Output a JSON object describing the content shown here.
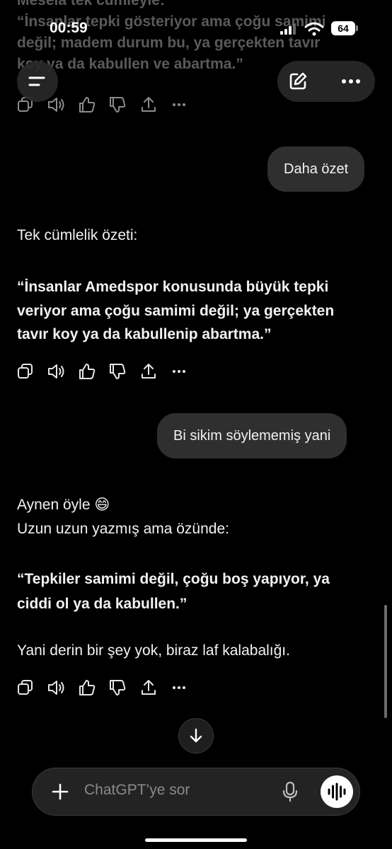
{
  "previous_message": {
    "line1": "Mesela tek cümleyle:",
    "line2": "“İnsanlar tepki gösteriyor ama çoğu samimi",
    "line3": "değil; madem durum bu, ya gerçekten tavır",
    "line4": "koy ya da kabullen ve abartma.”"
  },
  "status_bar": {
    "time": "00:59",
    "battery": "64"
  },
  "conversation": {
    "user_message_1": "Daha özet",
    "assistant_1": {
      "intro": "Tek cümlelik özeti:",
      "quote_line1": "“İnsanlar Amedspor konusunda büyük tepki",
      "quote_line2": "veriyor ama çoğu samimi değil; ya gerçekten",
      "quote_line3": "tavır koy ya da kabullenip abartma.”"
    },
    "user_message_2": "Bi sikim söylememiş yani",
    "assistant_2": {
      "line1": "Aynen öyle 😄",
      "line2": "Uzun uzun yazmış ama özünde:",
      "quote_line1": "“Tepkiler samimi değil, çoğu boş yapıyor, ya",
      "quote_line2": "ciddi ol ya da kabullen.”",
      "closing": "Yani derin bir şey yok, biraz laf kalabalığı."
    }
  },
  "composer": {
    "placeholder": "ChatGPT’ye sor"
  },
  "icons": {
    "copy": "copy-icon",
    "read_aloud": "speaker-icon",
    "like": "thumbs-up-icon",
    "dislike": "thumbs-down-icon",
    "share": "share-icon",
    "more": "more-icon"
  }
}
